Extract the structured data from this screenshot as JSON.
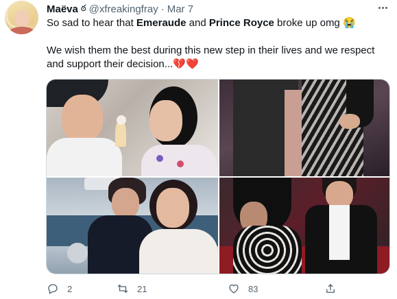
{
  "tweet": {
    "display_name": "Maëva",
    "name_emoji": "ఠ",
    "handle": "@xfreakingfray",
    "separator": "·",
    "date": "Mar 7",
    "text": {
      "line1_prefix": "So sad to hear that ",
      "name1": "Emeraude",
      "line1_mid": " and ",
      "name2": "Prince Royce",
      "line1_suffix": " broke up omg 😭",
      "line2": "We wish them the best during this new step in their lives and we respect",
      "line3": "and support their decision...💔❤️"
    },
    "media": {
      "photos": [
        {
          "description_icon": "photo-couple-ice-cream"
        },
        {
          "description_icon": "photo-couple-embrace"
        },
        {
          "description_icon": "photo-couple-wedding"
        },
        {
          "description_icon": "photo-couple-red-carpet"
        }
      ]
    },
    "actions": {
      "reply_count": "2",
      "retweet_count": "21",
      "like_count": "83"
    }
  },
  "colors": {
    "text_primary": "#0f1419",
    "text_secondary": "#536471",
    "border": "#cfd9de"
  }
}
